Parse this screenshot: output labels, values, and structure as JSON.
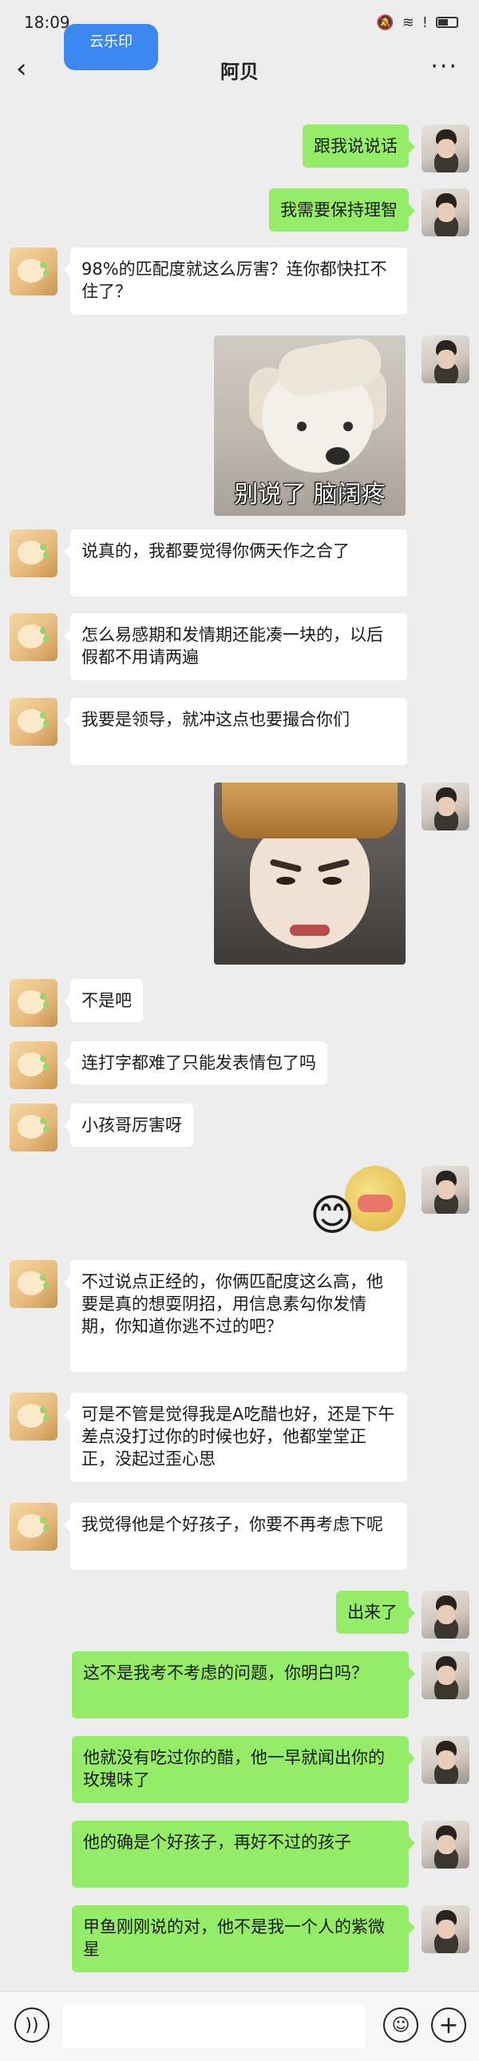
{
  "status_bar": {
    "time": "18:09"
  },
  "nav": {
    "title": "阿贝",
    "back_glyph": "‹",
    "more_glyph": "···",
    "floating_tab": "云乐印"
  },
  "messages": [
    {
      "side": "right",
      "kind": "text",
      "text": "跟我说说话"
    },
    {
      "side": "right",
      "kind": "text",
      "text": "我需要保持理智"
    },
    {
      "side": "left",
      "kind": "text",
      "text": "98%的匹配度就这么厉害？连你都快扛不住了？"
    },
    {
      "side": "right",
      "kind": "sticker",
      "sticker": "dog",
      "caption": "别说了 脑阔疼"
    },
    {
      "side": "left",
      "kind": "text",
      "text": "说真的，我都要觉得你俩天作之合了"
    },
    {
      "side": "left",
      "kind": "text",
      "text": "怎么易感期和发情期还能凑一块的，以后假都不用请两遍"
    },
    {
      "side": "left",
      "kind": "text",
      "text": "我要是领导，就冲这点也要撮合你们"
    },
    {
      "side": "right",
      "kind": "sticker",
      "sticker": "face"
    },
    {
      "side": "left",
      "kind": "text",
      "text": "不是吧"
    },
    {
      "side": "left",
      "kind": "text",
      "text": "连打字都难了只能发表情包了吗"
    },
    {
      "side": "left",
      "kind": "text",
      "text": "小孩哥厉害呀"
    },
    {
      "side": "right",
      "kind": "sticker",
      "sticker": "emoji"
    },
    {
      "side": "left",
      "kind": "text",
      "text": "不过说点正经的，你俩匹配度这么高，他要是真的想耍阴招，用信息素勾你发情期，你知道你逃不过的吧？"
    },
    {
      "side": "left",
      "kind": "text",
      "text": "可是不管是觉得我是A吃醋也好，还是下午差点没打过你的时候也好，他都堂堂正正，没起过歪心思"
    },
    {
      "side": "left",
      "kind": "text",
      "text": "我觉得他是个好孩子，你要不再考虑下呢"
    },
    {
      "side": "right",
      "kind": "text",
      "text": "出来了"
    },
    {
      "side": "right",
      "kind": "text",
      "text": "这不是我考不考虑的问题，你明白吗？"
    },
    {
      "side": "right",
      "kind": "text",
      "text": "他就没有吃过你的醋，他一早就闻出你的玫瑰味了"
    },
    {
      "side": "right",
      "kind": "text",
      "text": "他的确是个好孩子，再好不过的孩子"
    },
    {
      "side": "right",
      "kind": "text",
      "text": "甲鱼刚刚说的对，他不是我一个人的紫微星"
    }
  ],
  "input_bar": {
    "voice_icon": "voice-icon",
    "emoji_icon": "emoji-icon",
    "plus_icon": "plus-icon"
  },
  "colors": {
    "background": "#ededed",
    "bubble_self": "#95ec69",
    "bubble_other": "#ffffff"
  }
}
